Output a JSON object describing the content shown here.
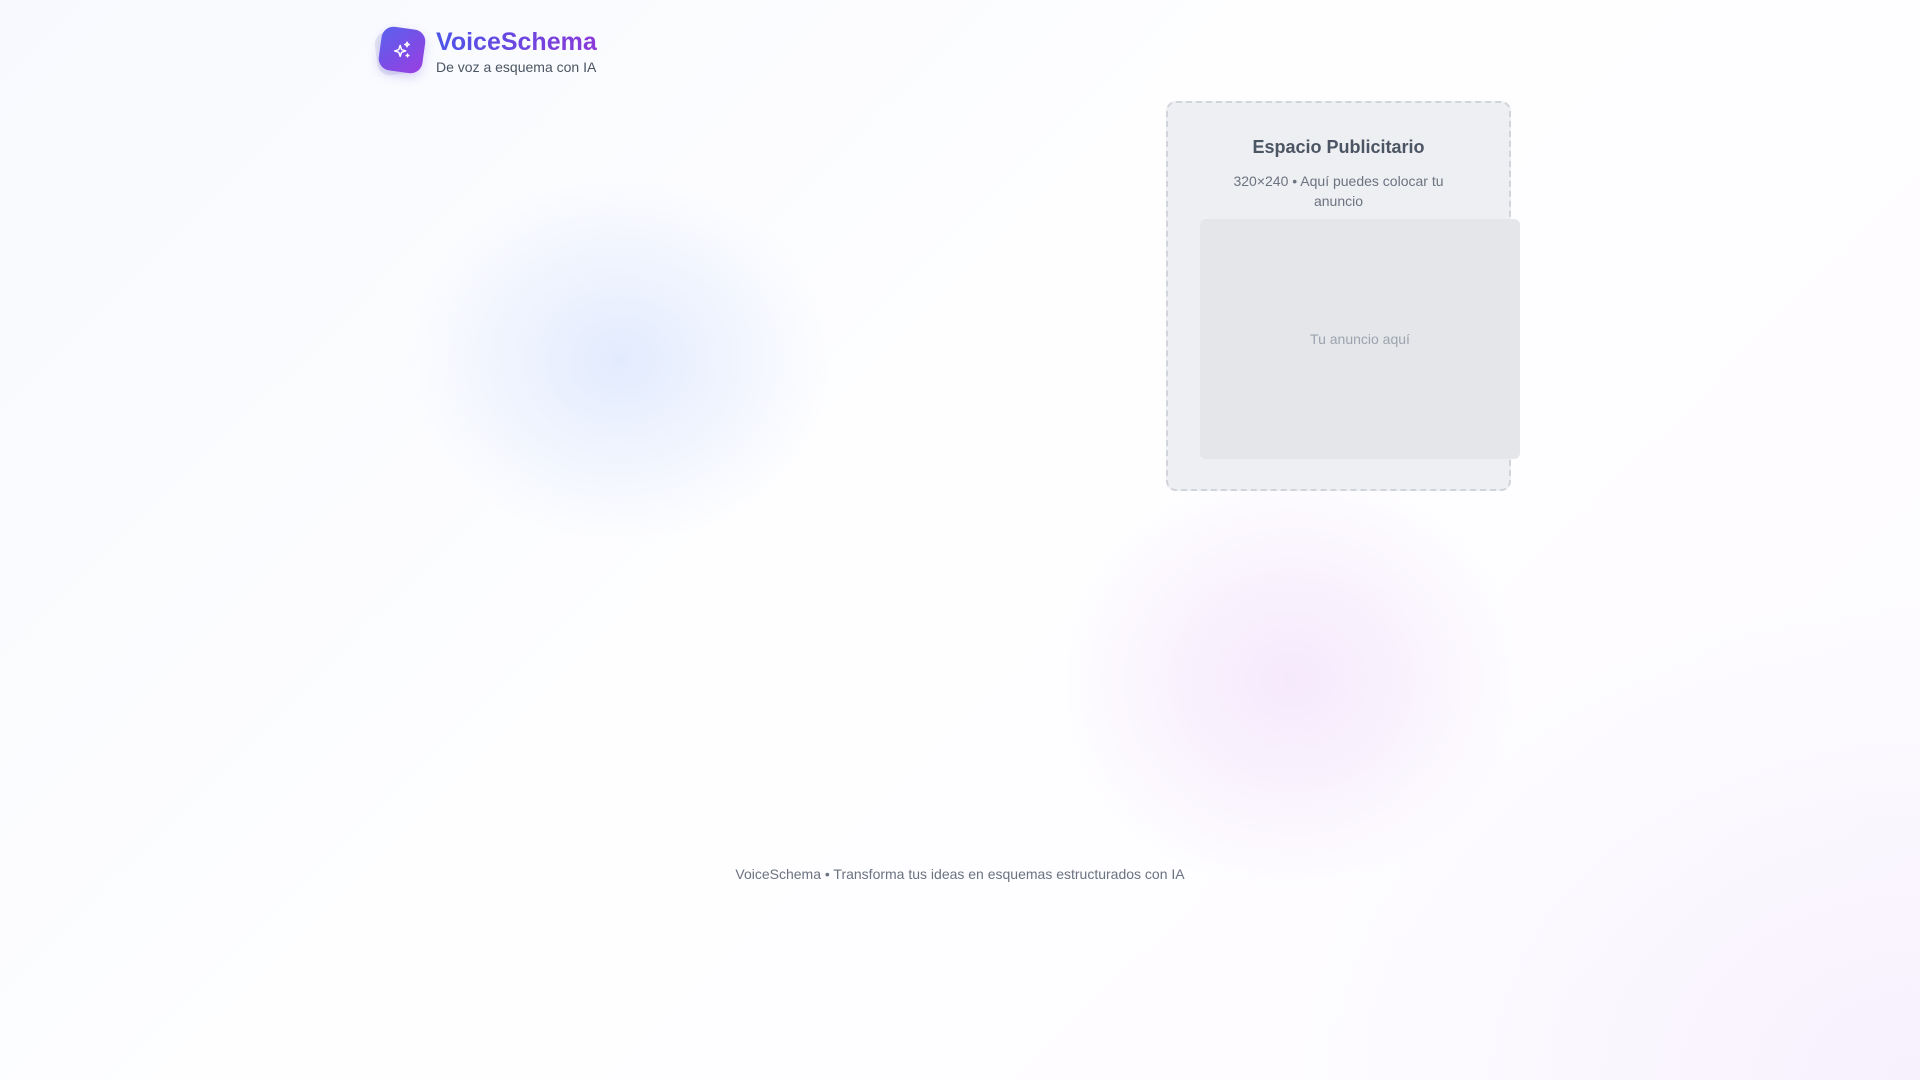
{
  "brand": {
    "name": "VoiceSchema",
    "tagline": "De voz a esquema con IA",
    "logo_icon": "sparkles-icon",
    "accent_start": "#4d55e8",
    "accent_end": "#8a39d8"
  },
  "ad": {
    "title": "Espacio Publicitario",
    "description": "320×240 • Aquí puedes colocar tu anuncio",
    "placeholder": "Tu anuncio aquí"
  },
  "footer": {
    "text": "VoiceSchema • Transforma tus ideas en esquemas estructurados con IA"
  }
}
